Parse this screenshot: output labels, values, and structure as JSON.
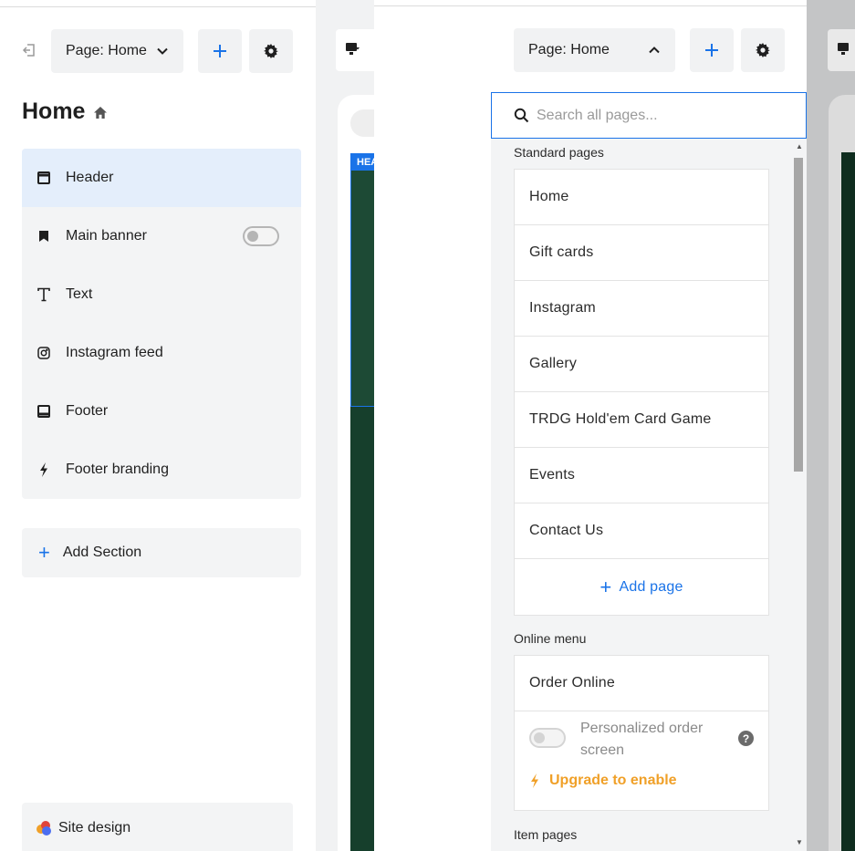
{
  "editor": {
    "page_selector_label": "Page: Home",
    "page_title": "Home",
    "sections": [
      {
        "label": "Header",
        "icon": "header-icon"
      },
      {
        "label": "Main banner",
        "icon": "bookmark-icon"
      },
      {
        "label": "Text",
        "icon": "text-icon"
      },
      {
        "label": "Instagram feed",
        "icon": "instagram-icon"
      },
      {
        "label": "Footer",
        "icon": "footer-icon"
      },
      {
        "label": "Footer branding",
        "icon": "lightning-icon"
      }
    ],
    "add_section_label": "Add Section",
    "site_design_label": "Site design"
  },
  "preview": {
    "header_tag": "HEADER"
  },
  "dropdown": {
    "page_selector_label": "Page: Home",
    "search_placeholder": "Search all pages...",
    "standard_pages_label": "Standard pages",
    "standard_pages": [
      "Home",
      "Gift cards",
      "Instagram",
      "Gallery",
      "TRDG Hold'em Card Game",
      "Events",
      "Contact Us"
    ],
    "add_page_label": "Add page",
    "online_menu_label": "Online menu",
    "order_online_label": "Order Online",
    "personalized_label": "Personalized order screen",
    "upgrade_label": "Upgrade to enable",
    "item_pages_label": "Item pages"
  },
  "colors": {
    "accent": "#1a73e8",
    "upgrade": "#f0a028",
    "active_section_bg": "#e4eefb"
  }
}
